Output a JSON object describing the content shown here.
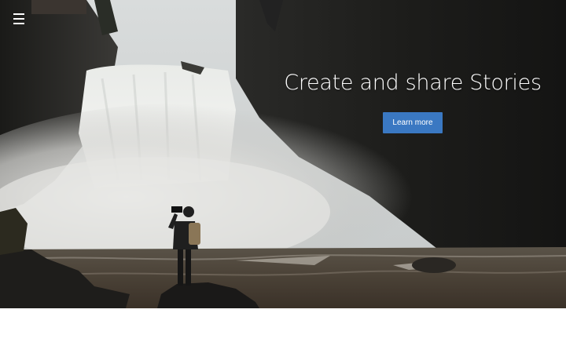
{
  "header": {
    "menu_icon": "hamburger-menu-icon"
  },
  "hero": {
    "title": "Create and share Stories",
    "cta_label": "Learn more",
    "image": "waterfall-photographer-image"
  },
  "colors": {
    "cta_background": "#3a78c2",
    "hero_text": "#ffffff",
    "page_background": "#ffffff"
  }
}
